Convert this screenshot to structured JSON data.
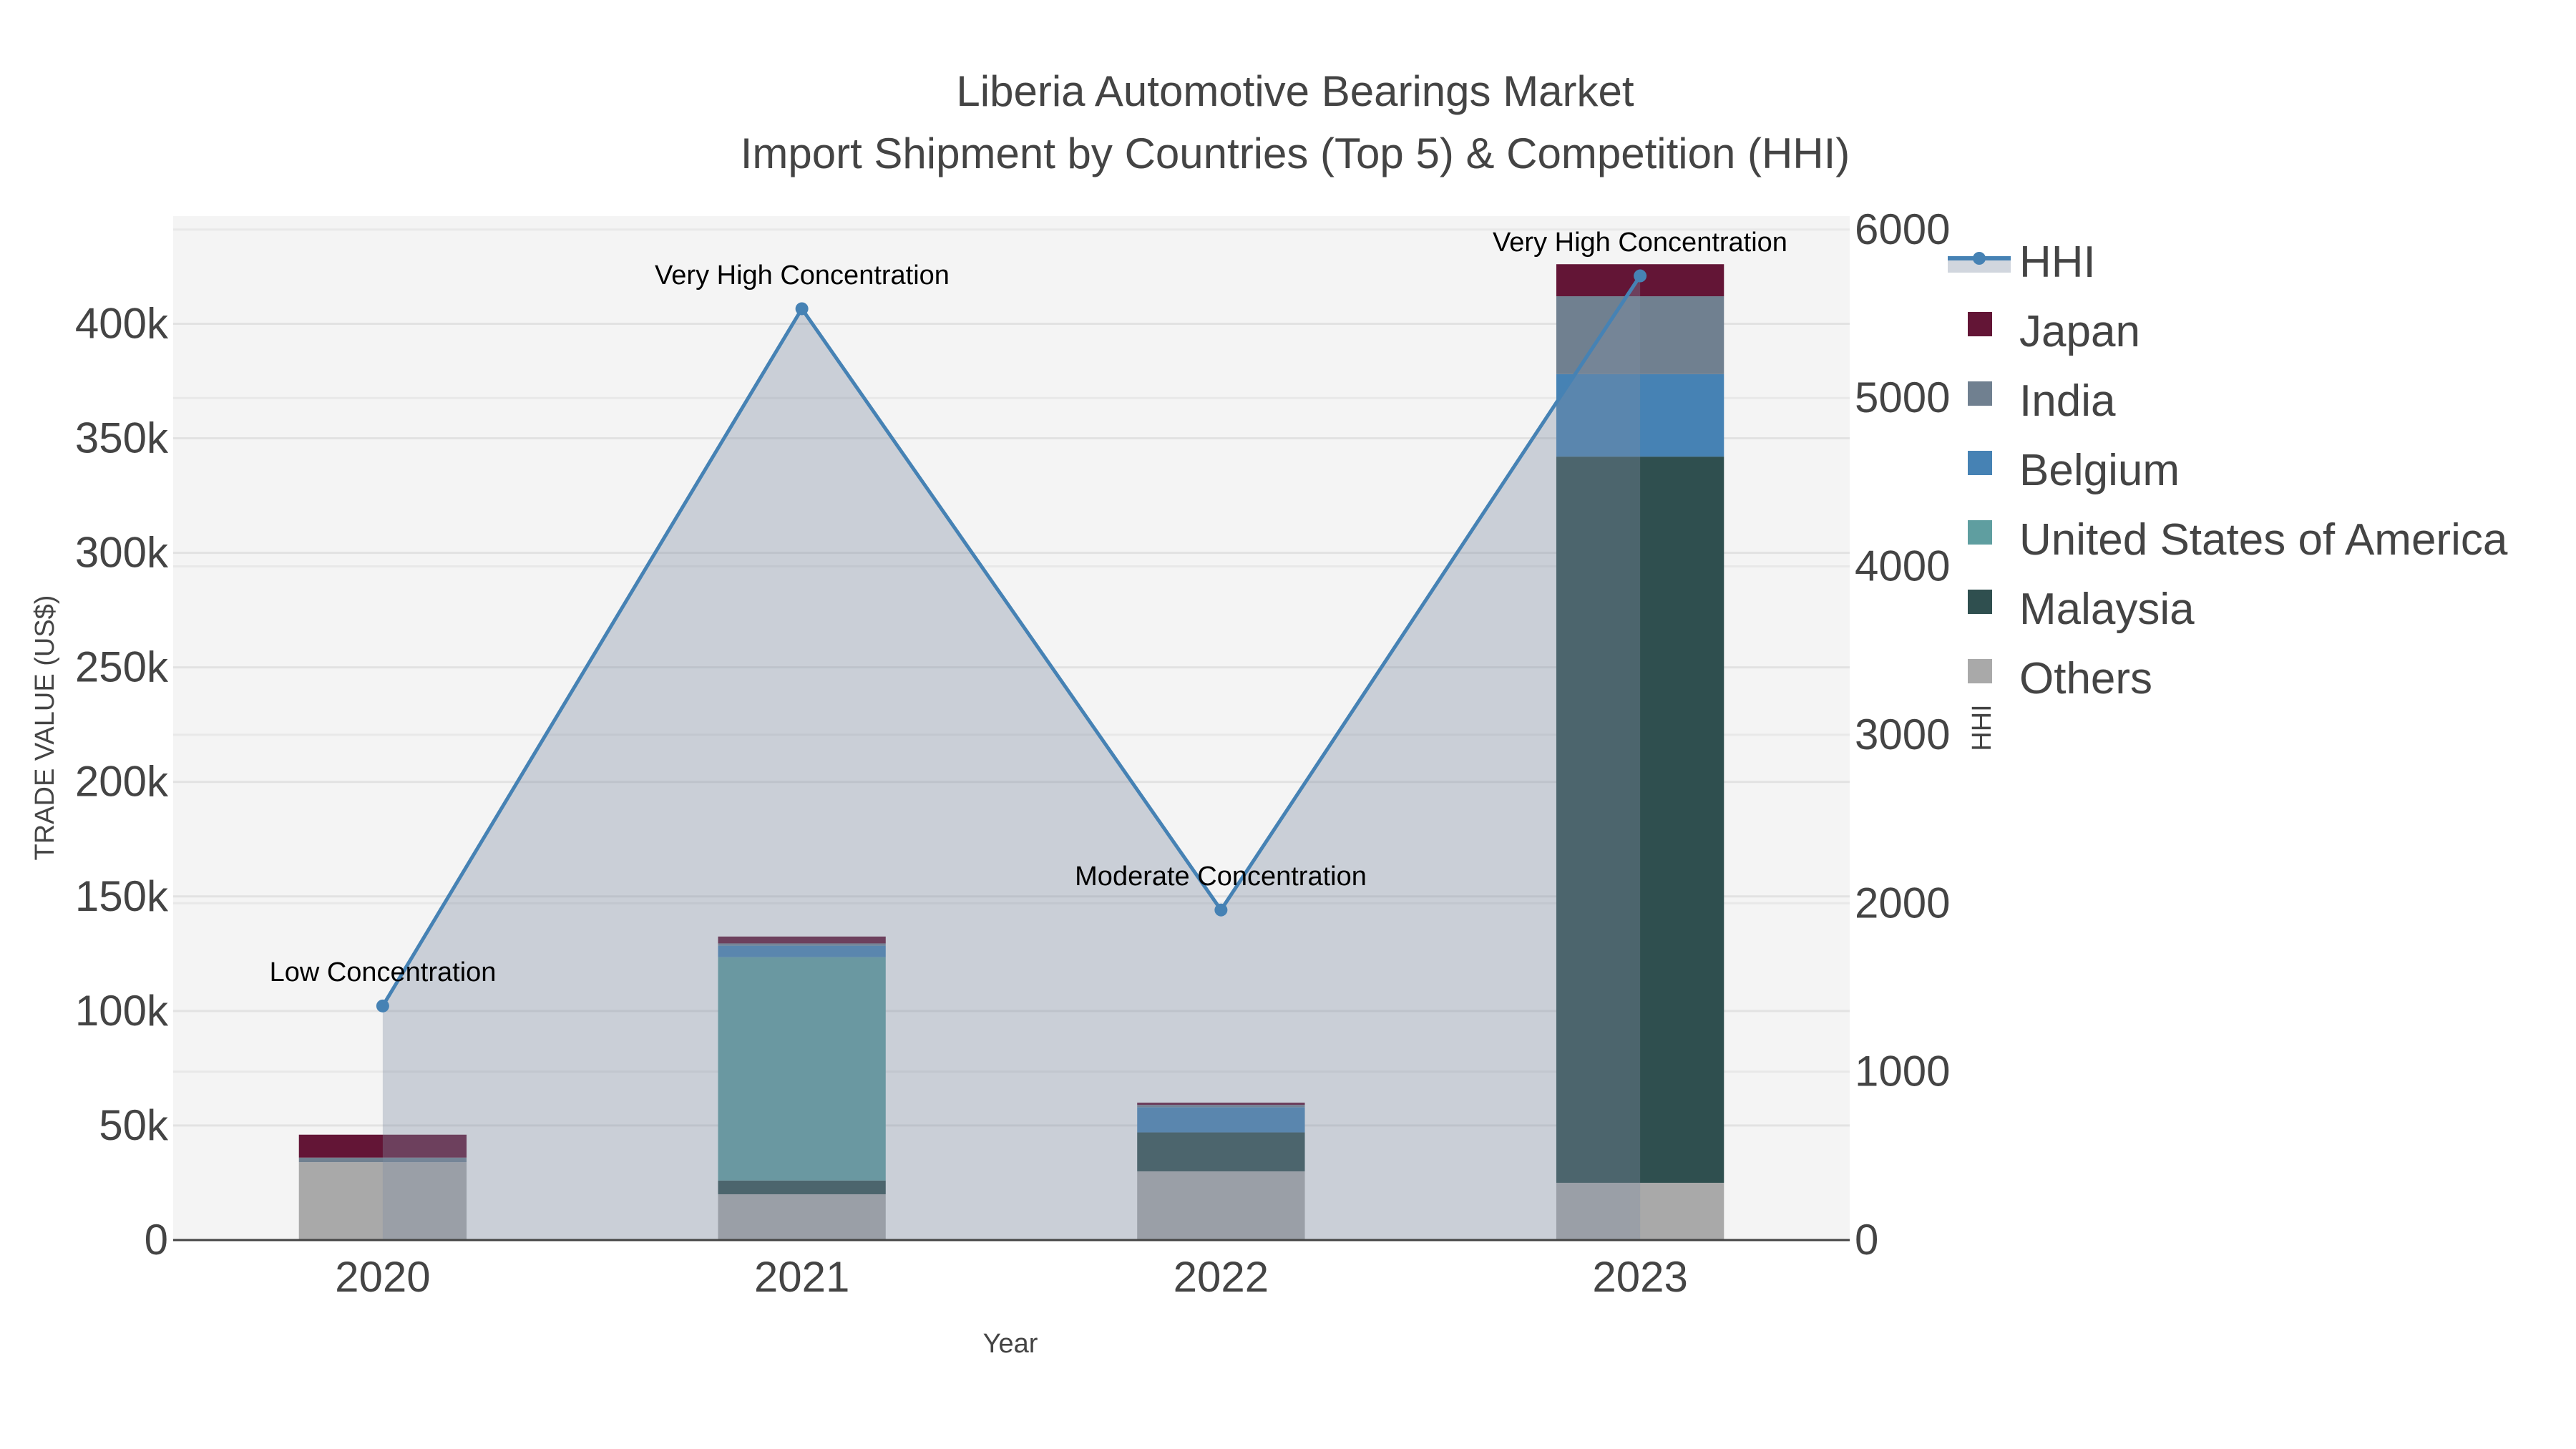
{
  "chart_data": {
    "type": "bar",
    "title": "Liberia Automotive Bearings Market",
    "subtitle": "Import Shipment by Countries (Top 5) & Competition (HHI)",
    "xlabel": "Year",
    "ylabel": "TRADE VALUE (US$)",
    "y2label": "HHI",
    "categories": [
      "2020",
      "2021",
      "2022",
      "2023"
    ],
    "ylim": [
      0,
      447000
    ],
    "y2lim": [
      0,
      6080
    ],
    "yticks": [
      0,
      50000,
      100000,
      150000,
      200000,
      250000,
      300000,
      350000,
      400000
    ],
    "ytick_labels": [
      "0",
      "50k",
      "100k",
      "150k",
      "200k",
      "250k",
      "300k",
      "350k",
      "400k"
    ],
    "y2ticks": [
      0,
      1000,
      2000,
      3000,
      4000,
      5000,
      6000
    ],
    "y2tick_labels": [
      "0",
      "1000",
      "2000",
      "3000",
      "4000",
      "5000",
      "6000"
    ],
    "stacked": true,
    "series": [
      {
        "name": "Others",
        "color": "#a9a9a9",
        "values": [
          34000,
          20000,
          30000,
          25000
        ]
      },
      {
        "name": "Malaysia",
        "color": "#2f4f4f",
        "values": [
          0,
          6000,
          17000,
          317000
        ]
      },
      {
        "name": "United States of America",
        "color": "#5f9ea0",
        "values": [
          0,
          97500,
          0,
          0
        ]
      },
      {
        "name": "Belgium",
        "color": "#4682b4",
        "values": [
          0,
          5000,
          11000,
          36000
        ]
      },
      {
        "name": "India",
        "color": "#708090",
        "values": [
          2000,
          1000,
          1000,
          34000
        ]
      },
      {
        "name": "Japan",
        "color": "#631536",
        "values": [
          10000,
          3000,
          1000,
          14000
        ]
      }
    ],
    "line": {
      "name": "HHI",
      "color": "#4682b4",
      "axis": "y2",
      "values": [
        1390,
        5530,
        1960,
        5725
      ]
    },
    "annotations": [
      "Low Concentration",
      "Very High Concentration",
      "Moderate Concentration",
      "Very High Concentration"
    ],
    "legend_order": [
      "HHI",
      "Japan",
      "India",
      "Belgium",
      "United States of America",
      "Malaysia",
      "Others"
    ],
    "legend_position": "right",
    "grid": true
  }
}
